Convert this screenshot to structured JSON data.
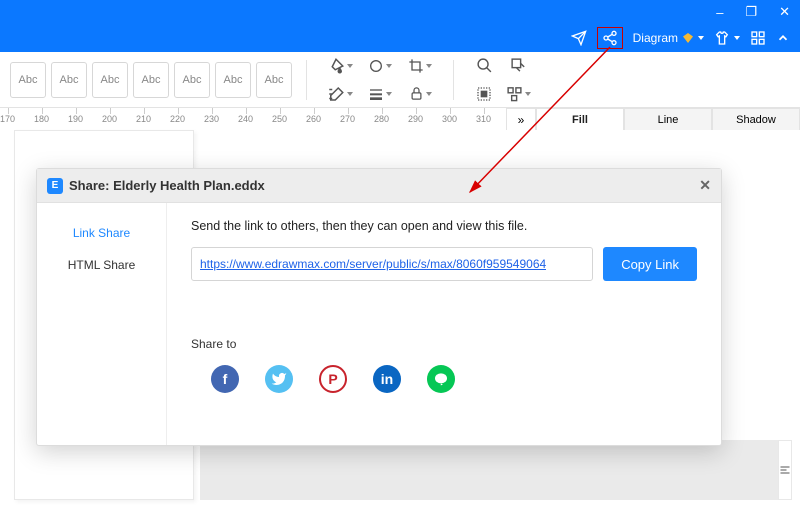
{
  "window_controls": {
    "min": "–",
    "max": "❐",
    "close": "✕"
  },
  "menubar": {
    "diagram_label": "Diagram"
  },
  "abc_labels": [
    "Abc",
    "Abc",
    "Abc",
    "Abc",
    "Abc",
    "Abc",
    "Abc"
  ],
  "ruler_ticks": [
    170,
    180,
    190,
    200,
    210,
    220,
    230,
    240,
    250,
    260,
    270,
    280,
    290,
    300,
    310
  ],
  "panel": {
    "collapse": "»",
    "tabs": [
      "Fill",
      "Line",
      "Shadow"
    ],
    "active": "Fill"
  },
  "dialog": {
    "title": "Share: Elderly Health Plan.eddx",
    "logo_letter": "E",
    "sidebar": {
      "link_share": "Link Share",
      "html_share": "HTML Share"
    },
    "instruction": "Send the link to others, then they can open and view this file.",
    "link_url": "https://www.edrawmax.com/server/public/s/max/8060f959549064",
    "copy_label": "Copy Link",
    "share_to": "Share to",
    "social": {
      "fb": "f",
      "tw": "t",
      "pt": "P",
      "li": "in",
      "ln": "◎"
    }
  }
}
